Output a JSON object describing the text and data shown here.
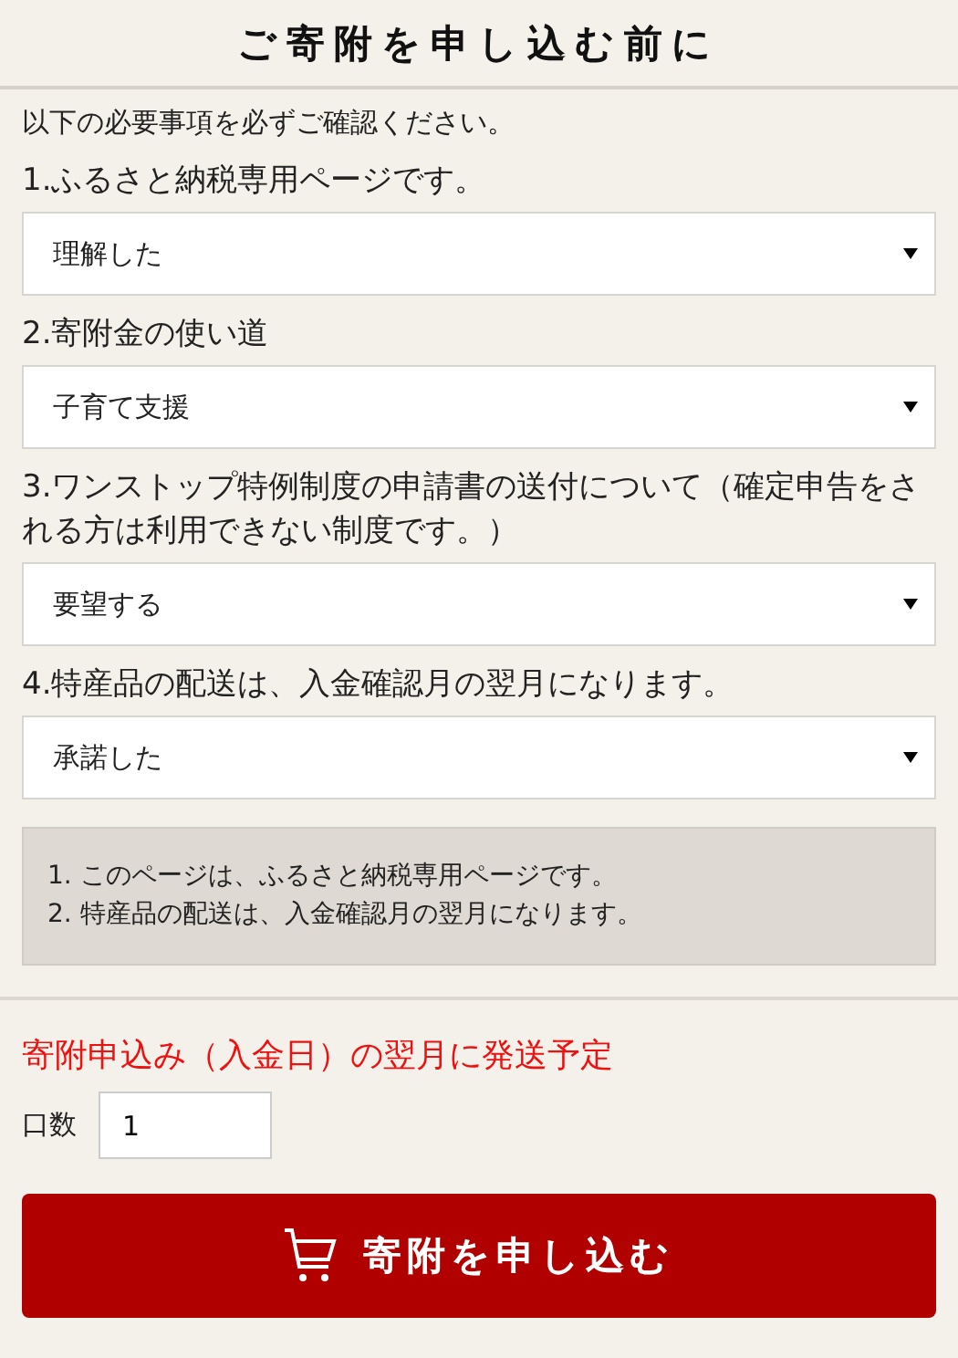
{
  "header": {
    "title": "ご寄附を申し込む前に"
  },
  "intro": "以下の必要事項を必ずご確認ください。",
  "questions": [
    {
      "label": "1.ふるさと納税専用ページです。",
      "value": "理解した"
    },
    {
      "label": "2.寄附金の使い道",
      "value": "子育て支援"
    },
    {
      "label": "3.ワンストップ特例制度の申請書の送付について（確定申告をされる方は利用できない制度です。）",
      "value": "要望する"
    },
    {
      "label": "4.特産品の配送は、入金確認月の翌月になります。",
      "value": "承諾した"
    }
  ],
  "notes": [
    "1. このページは、ふるさと納税専用ページです。",
    "2. 特産品の配送は、入金確認月の翌月になります。"
  ],
  "shipping_notice": "寄附申込み（入金日）の翌月に発送予定",
  "quantity": {
    "label": "口数",
    "value": "1"
  },
  "submit_button": {
    "label": "寄附を申し込む"
  }
}
